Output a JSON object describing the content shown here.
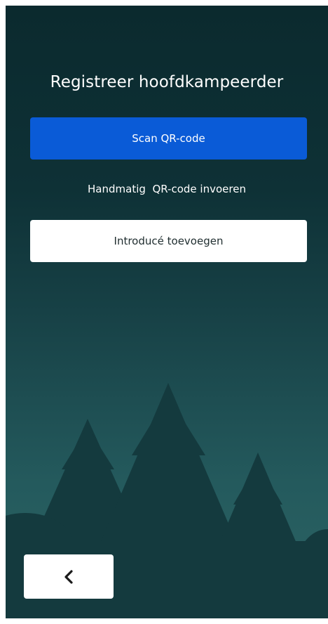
{
  "header": {
    "title": "Registreer hoofdkampeerder"
  },
  "actions": {
    "scan_label": "Scan QR-code",
    "manual_label": "Handmatig  QR-code invoeren",
    "add_guest_label": "Introducé toevoegen"
  },
  "footer": {
    "back_icon": "chevron-left-icon"
  },
  "colors": {
    "background": "#0e3136",
    "primary": "#0a5bd7",
    "tree": "#143a3e",
    "text": "#ffffff"
  }
}
